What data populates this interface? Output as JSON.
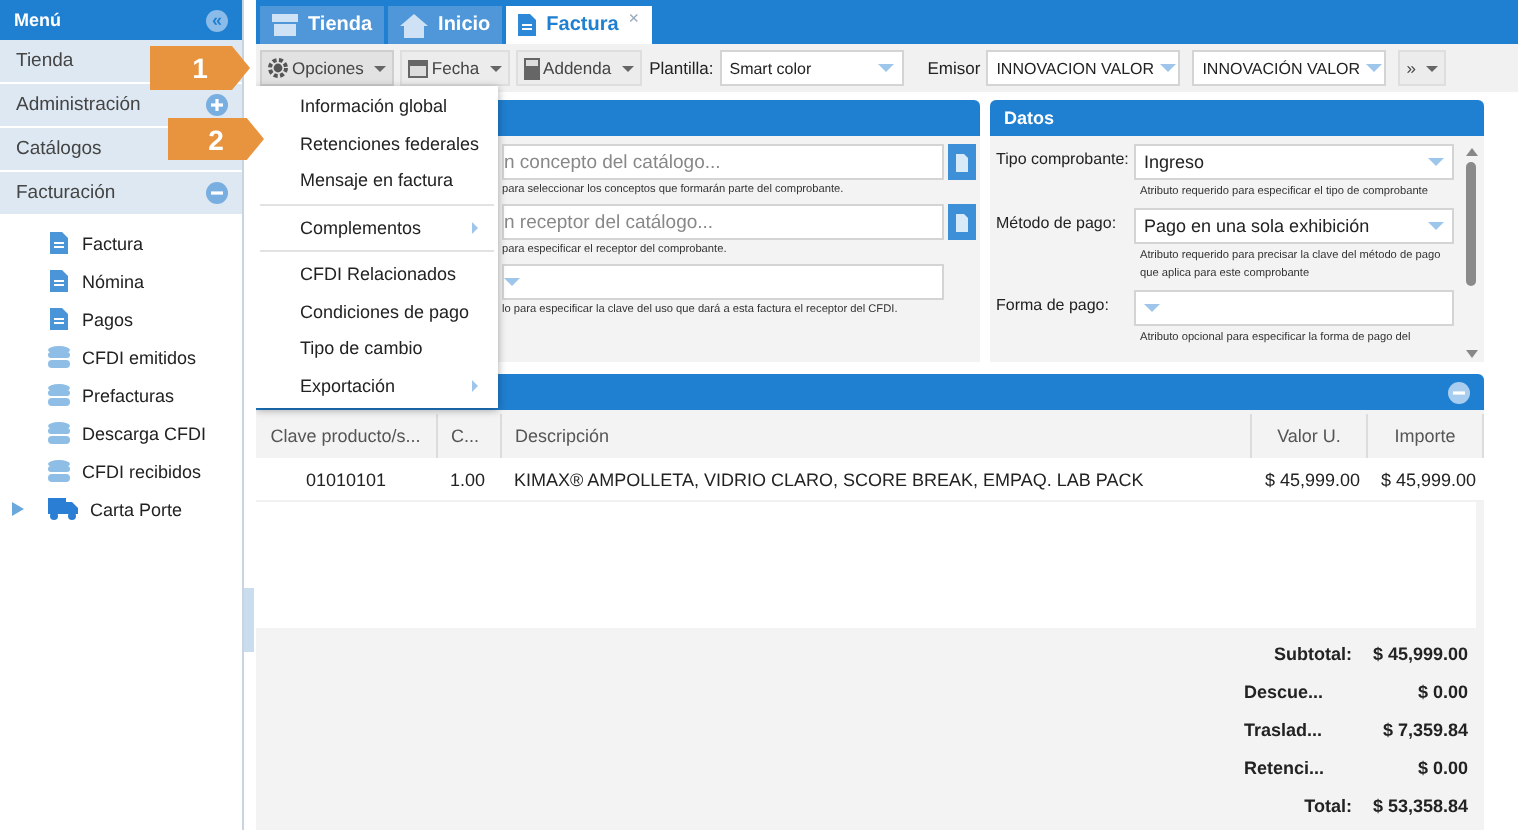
{
  "sidebar": {
    "title": "Menú",
    "collapse": "«",
    "sections": [
      {
        "label": "Tienda"
      },
      {
        "label": "Administración",
        "expanded": false
      },
      {
        "label": "Catálogos"
      },
      {
        "label": "Facturación",
        "expanded": true
      }
    ],
    "items": [
      {
        "label": "Factura"
      },
      {
        "label": "Nómina"
      },
      {
        "label": "Pagos"
      },
      {
        "label": "CFDI emitidos"
      },
      {
        "label": "Prefacturas"
      },
      {
        "label": "Descarga CFDI"
      },
      {
        "label": "CFDI recibidos"
      },
      {
        "label": "Carta Porte",
        "expanded": false
      }
    ]
  },
  "tabs": [
    {
      "label": "Tienda",
      "selected": false
    },
    {
      "label": "Inicio",
      "selected": false
    },
    {
      "label": "Factura",
      "selected": true,
      "close": "×"
    }
  ],
  "toolbar": {
    "buttons": [
      {
        "label": "Opciones",
        "expanded": true
      },
      {
        "label": "Fecha",
        "expanded": false
      },
      {
        "label": "Addenda",
        "expanded": false
      }
    ],
    "template_label": "Plantilla:",
    "template": "Smart color",
    "issuer_label": "Emisor",
    "issuer": "INNOVACION VALOR",
    "issuer_name": "INNOVACIÓN VALOR",
    "more": "»"
  },
  "options_menu": [
    {
      "kind": "item",
      "label": "Información global"
    },
    {
      "kind": "item",
      "label": "Retenciones federales"
    },
    {
      "kind": "item",
      "label": "Mensaje en factura"
    },
    {
      "kind": "separator"
    },
    {
      "kind": "submenu",
      "label": "Complementos"
    },
    {
      "kind": "separator"
    },
    {
      "kind": "item",
      "label": "CFDI Relacionados"
    },
    {
      "kind": "item",
      "label": "Condiciones de pago"
    },
    {
      "kind": "item",
      "label": "Tipo de cambio"
    },
    {
      "kind": "submenu",
      "label": "Exportación"
    }
  ],
  "callouts": [
    {
      "label": "1"
    },
    {
      "label": "2"
    }
  ],
  "general_panel": {
    "fields": [
      {
        "kind": "lookup",
        "placeholder": "n concepto del catálogo...",
        "hint": "para seleccionar los conceptos que formarán parte del comprobante."
      },
      {
        "kind": "lookup",
        "placeholder": "n receptor del catálogo...",
        "hint": "para especificar el receptor del comprobante."
      },
      {
        "kind": "select",
        "hint": "lo para especificar la clave del uso que dará a esta factura el receptor del CFDI."
      }
    ]
  },
  "datos_panel": {
    "title": "Datos",
    "fields": [
      {
        "label": "Tipo comprobante:",
        "value": "Ingreso",
        "hint": "Atributo requerido para especificar el tipo de comprobante"
      },
      {
        "label": "Método de pago:",
        "value": "Pago en una sola exhibición",
        "hint": "Atributo requerido para precisar la clave del método de pago que aplica para este comprobante"
      },
      {
        "label": "Forma de pago:",
        "hint": "Atributo opcional para especificar la forma de pago del"
      }
    ]
  },
  "conceptos_panel": {
    "table": {
      "columns": [
        "Clave producto/s...",
        "C...",
        "Descripción",
        "Valor U.",
        "Importe"
      ],
      "rows": [
        [
          "01010101",
          "1.00",
          "KIMAX® AMPOLLETA, VIDRIO CLARO, SCORE BREAK, EMPAQ. LAB PACK",
          "$ 45,999.00",
          "$ 45,999.00"
        ]
      ]
    },
    "totals": [
      {
        "label": "Subtotal:",
        "value": "$ 45,999.00"
      },
      {
        "label": "Descue...",
        "value": "$ 0.00"
      },
      {
        "label": "Traslad...",
        "value": "$ 7,359.84"
      },
      {
        "label": "Retenci...",
        "value": "$ 0.00"
      },
      {
        "label": "Total:",
        "value": "$ 53,358.84"
      }
    ]
  }
}
